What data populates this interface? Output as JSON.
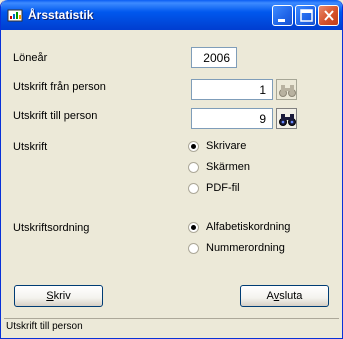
{
  "window": {
    "title": "Årsstatistik",
    "controls": [
      "minimize-icon",
      "maximize-icon",
      "close-icon"
    ]
  },
  "form": {
    "year_label": "Löneår",
    "year_value": "2006",
    "from_label": "Utskrift från person",
    "from_value": "1",
    "to_label": "Utskrift till person",
    "to_value": "9",
    "output_label": "Utskrift",
    "output_options": [
      {
        "label": "Skrivare",
        "checked": true
      },
      {
        "label": "Skärmen",
        "checked": false
      },
      {
        "label": "PDF-fil",
        "checked": false
      }
    ],
    "order_label": "Utskriftsordning",
    "order_options": [
      {
        "label": "Alfabetiskordning",
        "checked": true
      },
      {
        "label": "Nummerordning",
        "checked": false
      }
    ]
  },
  "buttons": {
    "print_prefix": "",
    "print_mnemonic": "S",
    "print_rest": "kriv",
    "exit_prefix": "A",
    "exit_mnemonic": "v",
    "exit_rest": "sluta"
  },
  "status": {
    "text": "Utskrift till person"
  },
  "colors": {
    "titlebar": "#0054e3",
    "face": "#ece9d8",
    "close_button": "#d6522c"
  }
}
